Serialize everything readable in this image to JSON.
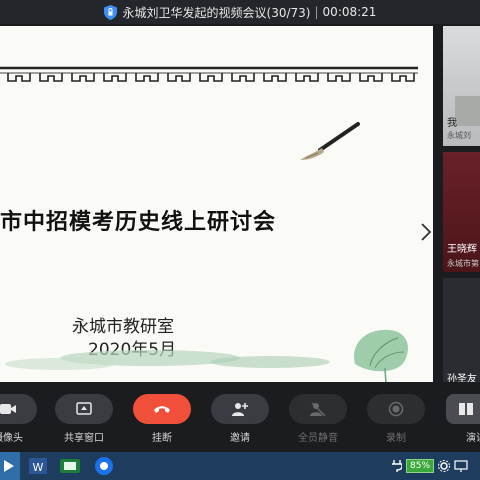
{
  "titlebar": {
    "meeting_title": "永城刘卫华发起的视频会议(30/73)",
    "separator": "|",
    "elapsed": "00:08:21"
  },
  "slide": {
    "title": "市中招模考历史线上研讨会",
    "organization": "永城市教研室",
    "date": "2020年5月"
  },
  "participants": [
    {
      "name": "我",
      "subtitle": "永城刘"
    },
    {
      "name": "王晓辉",
      "subtitle": "永城市第"
    },
    {
      "name": "孙圣友",
      "subtitle": ""
    }
  ],
  "controls": {
    "camera": "摄像头",
    "share": "共享窗口",
    "hangup": "挂断",
    "invite": "邀请",
    "mute_all": "全员静音",
    "record": "录制",
    "presentation": "演讲"
  },
  "taskbar": {
    "battery": "85%"
  },
  "colors": {
    "hangup": "#f0503a",
    "background": "#1b1c20",
    "taskbar": "#1e3d5e",
    "battery": "#3ca83c"
  }
}
